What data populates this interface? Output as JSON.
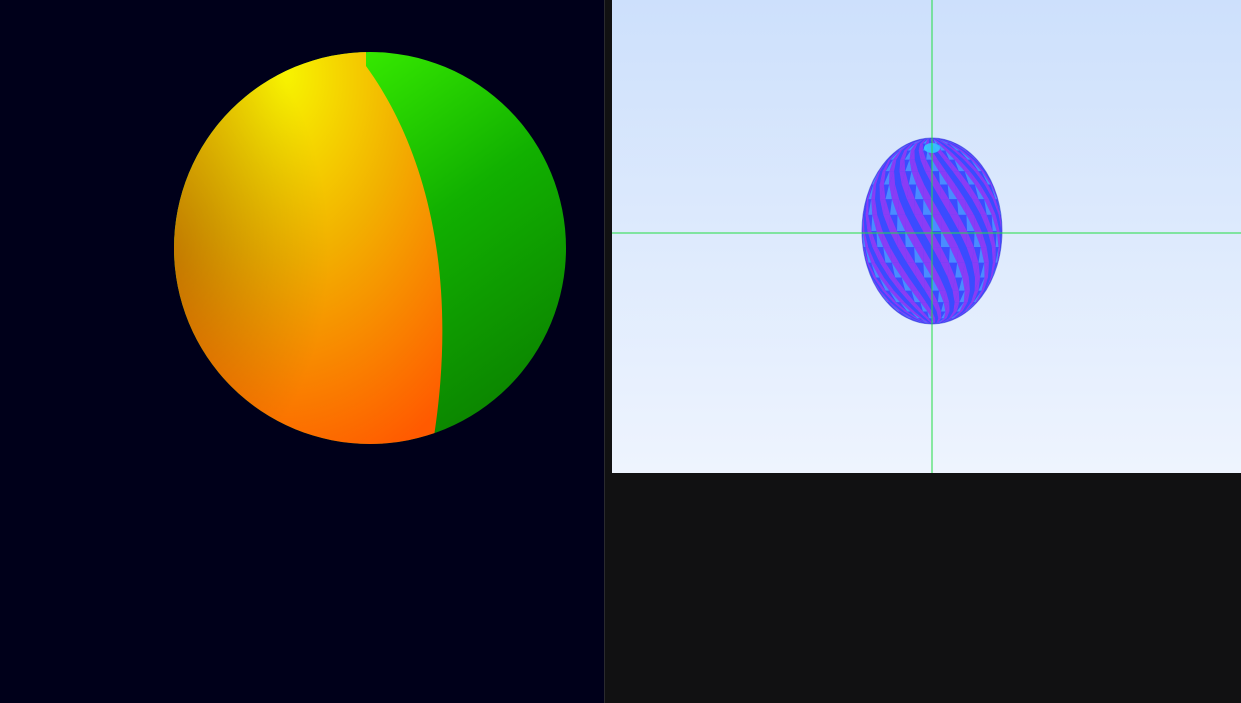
{
  "left_viewport": {
    "background": "#00001a",
    "sphere": {
      "warm_colors": [
        "#f7f300",
        "#f2b000",
        "#ff5a00"
      ],
      "cool_colors": [
        "#44ff00",
        "#11b000",
        "#0a7a00"
      ]
    }
  },
  "right_viewport": {
    "background_top": "#cde0fc",
    "background_bottom": "#eef4fe",
    "crosshair_color": "#22dd44",
    "ellipsoid": {
      "colors": [
        "#3a4cff",
        "#8a3cf5",
        "#4a8cff",
        "#2fd0ff"
      ]
    }
  },
  "bottom_panel": {
    "background": "#111112"
  }
}
